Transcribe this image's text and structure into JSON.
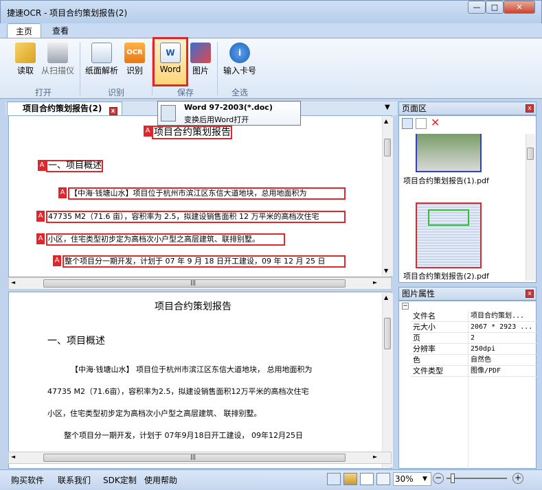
{
  "window": {
    "title": "捷速OCR - 项目合约策划报告(2)",
    "min": "—",
    "max": "□",
    "close": "✕"
  },
  "ribbon_tabs": [
    {
      "label": "主页"
    },
    {
      "label": "查看"
    }
  ],
  "ribbon": {
    "read": "读取",
    "scan": "从扫描仪",
    "layout": "纸面解析",
    "recognize": "识别",
    "word": "Word",
    "picture": "图片",
    "card": "输入卡号",
    "group_open": "打开",
    "group_recognize": "识别",
    "group_save": "保存",
    "group_selectall": "全选",
    "ocr_badge": "OCR",
    "word_badge": "W"
  },
  "tooltip": {
    "title": "Word 97-2003(*.doc)",
    "desc": "变换后用Word打开"
  },
  "doc_tab": {
    "label": "项目合约策划报告(2)"
  },
  "ocr_blocks": {
    "title": "项目合约策划报告",
    "h1": "一、项目概述",
    "l1": "【中海·钱塘山水】项目位于杭州市滨江区东信大道地块，总用地面积为",
    "l2": "47735 M2（71.6 亩），容积率为 2.5，拟建设销售面积 12 万平米的高档次住宅",
    "l3": "小区，住宅类型初步定为高档次小户型之高层建筑、联排别墅。",
    "l4": "整个项目分一期开发，计划于 07 年 9 月 18 日开工建设，09 年 12 月 25 日",
    "marker": "A"
  },
  "text_result": {
    "title": "项目合约策划报告",
    "h1": "一、项目概述",
    "l1": "【中海·钱塘山水】 项目位于杭州市滨江区东信大道地块， 总用地面积为",
    "l2": "47735 M2（71.6亩），容积率为2.5，拟建设销售面积12万平米的高档次住宅",
    "l3": "小区，住宅类型初步定为高档次小户型之高层建筑、 联排别墅。",
    "l4": "整个项目分一期开发，计划于 07年9月18日开工建设， 09年12月25日"
  },
  "page_panel": {
    "title": "页面区",
    "items": [
      {
        "label": "项目合约策划报告(1).pdf"
      },
      {
        "label": "项目合约策划报告(2).pdf"
      }
    ]
  },
  "props": {
    "title": "图片属性",
    "rows": [
      {
        "k": "文件名",
        "v": "项目合约策划..."
      },
      {
        "k": "元大小",
        "v": "2067 * 2923 ..."
      },
      {
        "k": "页",
        "v": "2"
      },
      {
        "k": "分辨率",
        "v": "250dpi"
      },
      {
        "k": "色",
        "v": "自然色"
      },
      {
        "k": "文件类型",
        "v": "图像/PDF"
      }
    ],
    "collapse": "−"
  },
  "status": {
    "buy": "购买软件",
    "contact": "联系我们",
    "sdk": "SDK定制",
    "help": "使用帮助",
    "zoom": "30%",
    "zoom_level": 0.3,
    "minus": "−",
    "plus": "+",
    "grip": "|||",
    "scroll_up": "▲",
    "scroll_down": "▼",
    "scroll_left": "◄",
    "scroll_right": "►",
    "dd": "▼",
    "close_x": "x"
  },
  "colors": {
    "highlight": "#e0262b",
    "accent": "#1a5aa8"
  }
}
